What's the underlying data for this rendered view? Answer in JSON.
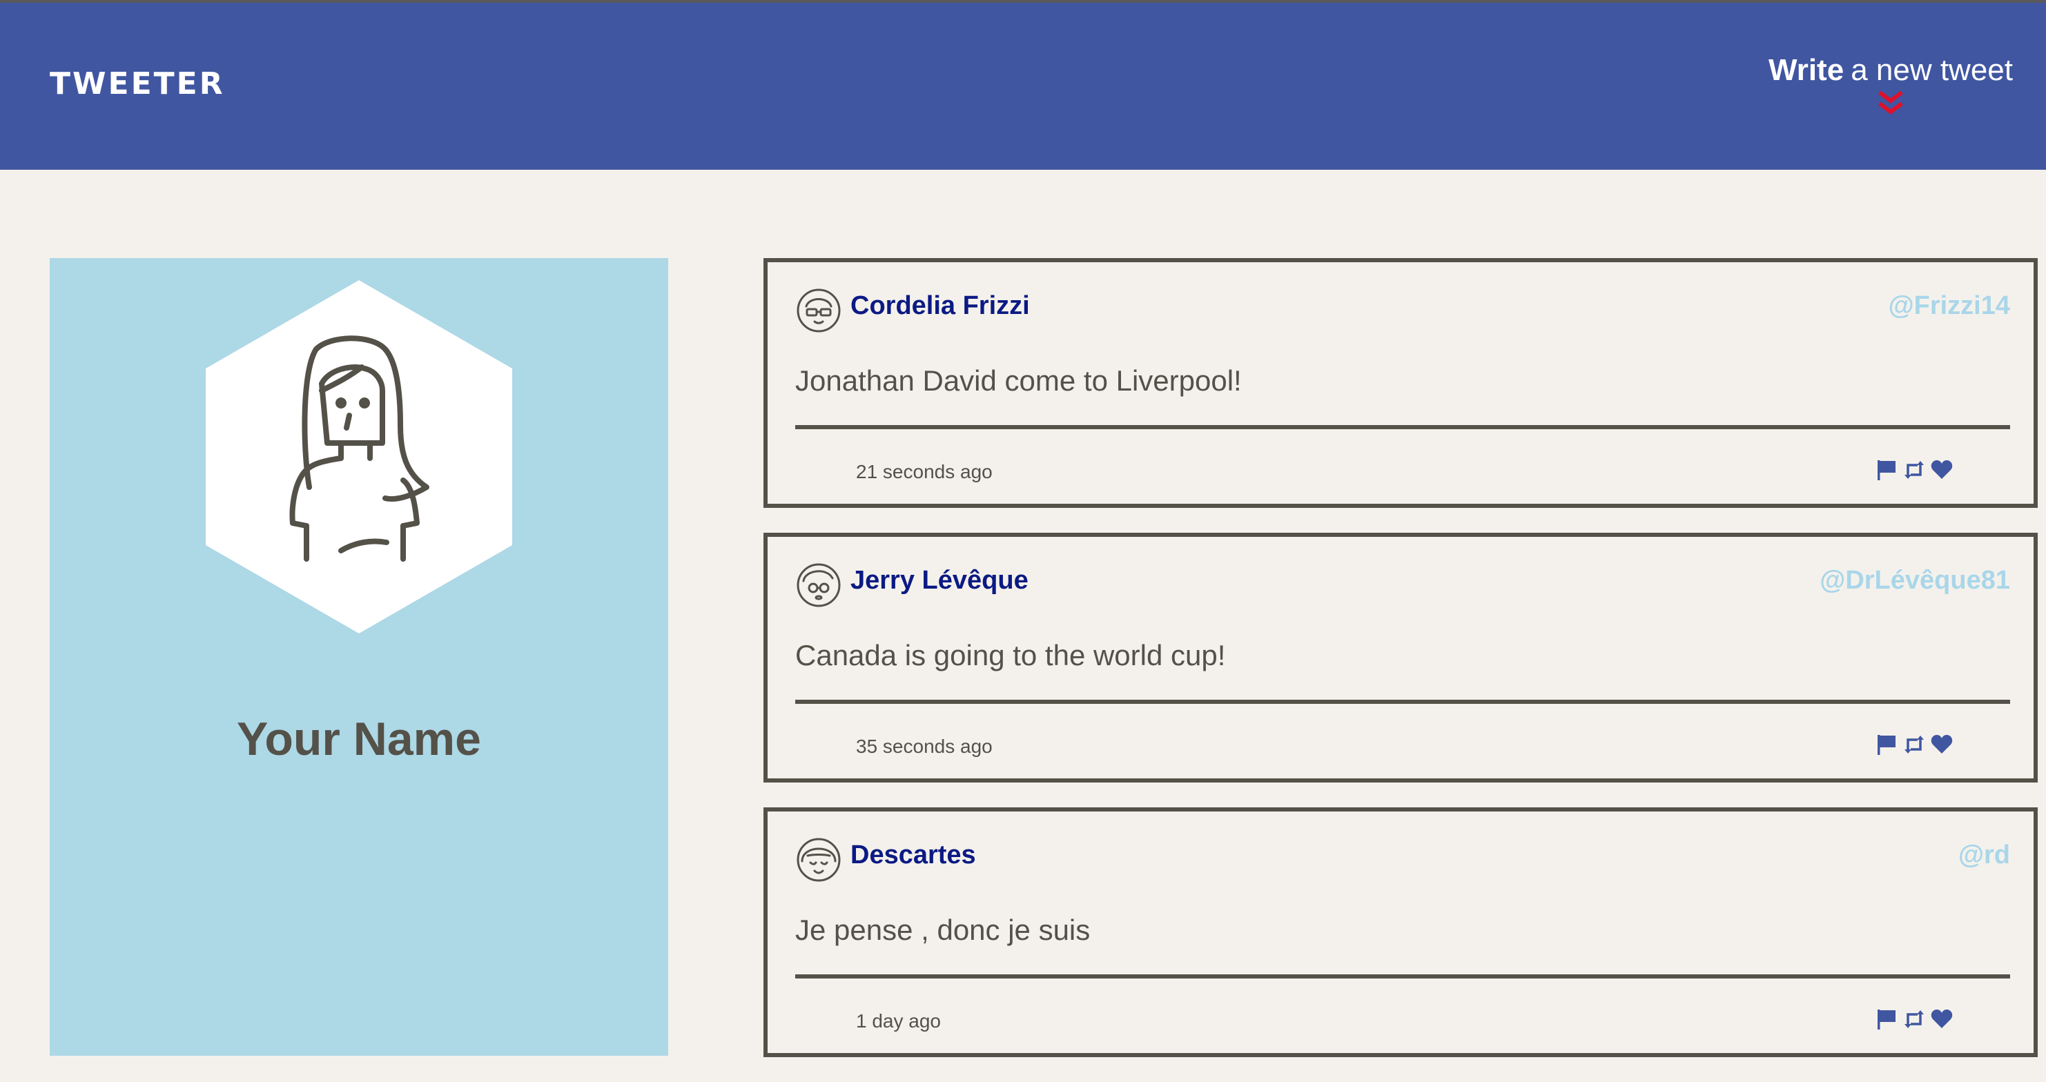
{
  "nav": {
    "brand": "TWEETER",
    "compose_strong": "Write",
    "compose_rest": "a new tweet"
  },
  "profile": {
    "name": "Your Name"
  },
  "tweets": [
    {
      "name": "Cordelia Frizzi",
      "handle": "@Frizzi14",
      "text": "Jonathan David come to Liverpool!",
      "time": "21 seconds ago"
    },
    {
      "name": "Jerry Lévêque",
      "handle": "@DrLévêque81",
      "text": "Canada is going to the world cup!",
      "time": "35 seconds ago"
    },
    {
      "name": "Descartes",
      "handle": "@rd",
      "text": "Je pense , donc je suis",
      "time": "1 day ago"
    }
  ],
  "colors": {
    "navbar": "#4056a1",
    "background": "#f4f1ec",
    "profile_panel": "#add8e6",
    "tweet_border": "#545149",
    "name": "#0b1a83",
    "handle": "#a9d6e9",
    "compose_arrow": "#e0102a",
    "action_icons": "#4056a1"
  },
  "icons": {
    "compose": "double-chevron-down-icon",
    "actions": [
      "flag-icon",
      "retweet-icon",
      "heart-icon"
    ]
  }
}
